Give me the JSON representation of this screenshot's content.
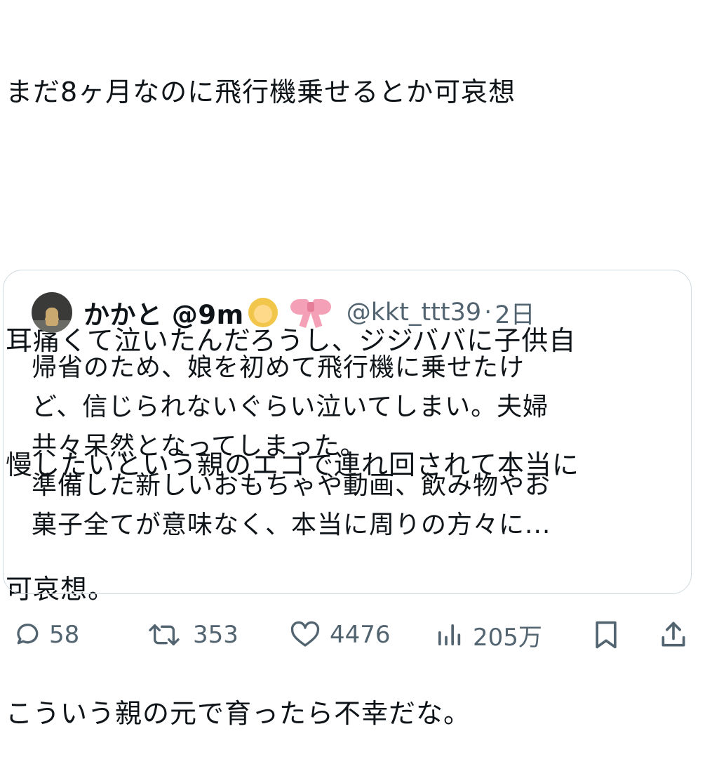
{
  "tweet": {
    "lines": [
      "まだ8ヶ月なのに飛行機乗せるとか可哀想",
      "",
      "耳痛くて泣いたんだろうし、ジジババに子供自",
      "慢したいという親のエゴで連れ回されて本当に",
      "可哀想。",
      "こういう親の元で育ったら不幸だな。"
    ]
  },
  "quote": {
    "display_name": "かかと @9m",
    "emojis": [
      "girl-emoji",
      "ribbon-emoji"
    ],
    "handle": "@kkt_ttt39",
    "separator": "·",
    "time": "2日",
    "lines": [
      "帰省のため、娘を初めて飛行機に乗せたけ",
      "ど、信じられないぐらい泣いてしまい。夫婦",
      "共々呆然となってしまった。",
      "準備した新しいおもちゃや動画、飲み物やお",
      "菓子全てが意味なく、本当に周りの方々に..."
    ]
  },
  "actions": {
    "reply_count": "58",
    "retweet_count": "353",
    "like_count": "4476",
    "views_count": "205万"
  },
  "colors": {
    "text": "#0f1419",
    "secondary": "#536471",
    "border": "#cfd9de"
  }
}
